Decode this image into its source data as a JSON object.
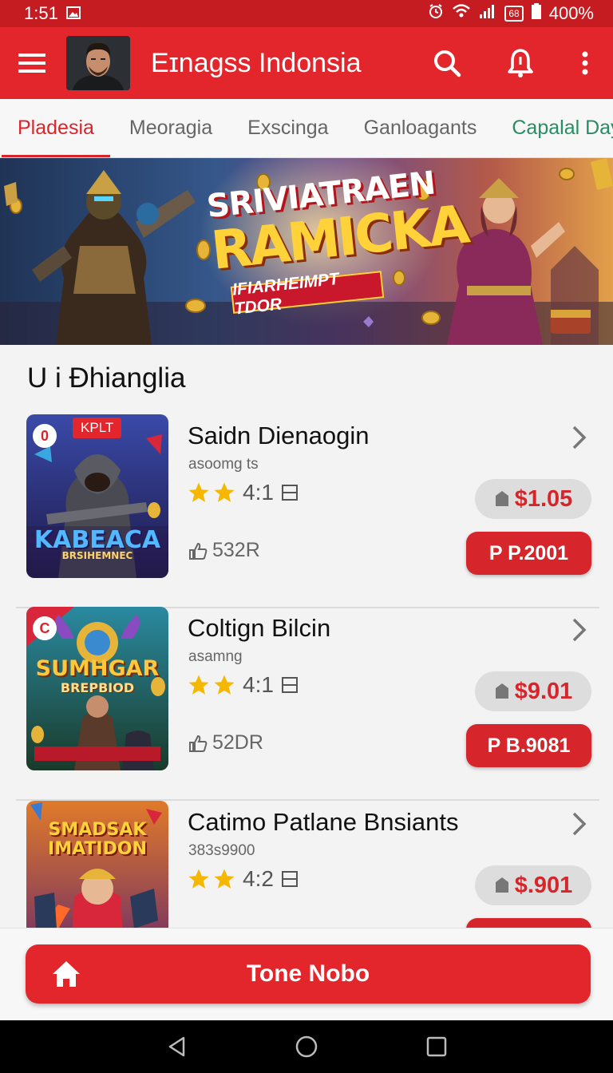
{
  "status_bar": {
    "time": "1:51",
    "battery_badge": "68",
    "battery": "400%"
  },
  "app_bar": {
    "title": "Eɪnagss Indonsia"
  },
  "tabs": [
    {
      "label": "Pladesia"
    },
    {
      "label": "Meoragia"
    },
    {
      "label": "Exscinga"
    },
    {
      "label": "Ganloagants"
    },
    {
      "label": "Capalal Day"
    }
  ],
  "banner": {
    "headline_line1": "SRIVIATRAEN",
    "headline_line2": "RAMICKA",
    "tag": "IFIARHEIMPT TDOR",
    "slide_count": 4,
    "active_slide": 1
  },
  "section": {
    "title": "U i Đhianglia"
  },
  "games": [
    {
      "name": "Saidn Dienaogin",
      "subtitle": "asoomg ts",
      "rating": "4:1",
      "stars": 2,
      "price": "$1.05",
      "meta": "532R",
      "buy_label": "P P.2001",
      "thumb_badge": "0",
      "thumb_tag": "KPLT",
      "thumb_title": "KABEACA",
      "thumb_subtitle": "BRSIHEMNEC"
    },
    {
      "name": "Coltign Bilcin",
      "subtitle": "asamng",
      "rating": "4:1",
      "stars": 2,
      "price": "$9.01",
      "meta": "52DR",
      "buy_label": "P B.9081",
      "thumb_badge": "C",
      "thumb_tag": "",
      "thumb_title": "SUMHGAR",
      "thumb_subtitle": "BREPBIOD"
    },
    {
      "name": "Catimo Patlane Bnsiants",
      "subtitle": "383s9900",
      "rating": "4:2",
      "stars": 2,
      "price": "$.901",
      "meta": "",
      "buy_label": "",
      "thumb_badge": "",
      "thumb_tag": "",
      "thumb_title": "SMADSAK",
      "thumb_subtitle": "IMATIDON"
    }
  ],
  "cta": {
    "label": "Tone Nobo"
  },
  "colors": {
    "primary": "#e2262b",
    "status_bar": "#c51c22",
    "active_tab": "#d7262b",
    "highlight_tab": "#2a8c62",
    "price": "#d7262b"
  }
}
